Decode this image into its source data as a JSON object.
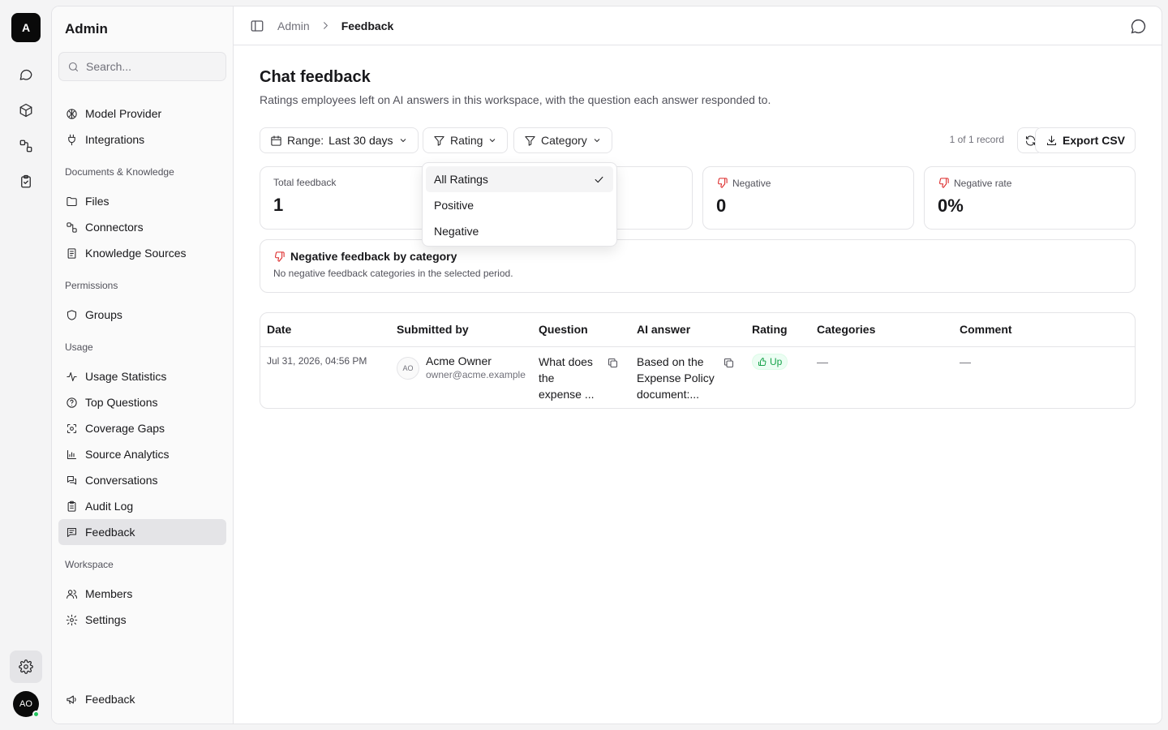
{
  "rail": {
    "logo_letter": "A",
    "user_initials": "AO",
    "icons": [
      "chat-icon",
      "cube-icon",
      "workflow-icon",
      "clipboard-check-icon",
      "settings-icon"
    ]
  },
  "sidebar": {
    "title": "Admin",
    "search_placeholder": "Search...",
    "top_items": [
      {
        "label": "Model Provider",
        "icon": "brain-icon"
      },
      {
        "label": "Integrations",
        "icon": "plug-icon"
      }
    ],
    "sections": [
      {
        "label": "Documents & Knowledge",
        "items": [
          {
            "label": "Files",
            "icon": "folder-icon"
          },
          {
            "label": "Connectors",
            "icon": "connector-icon"
          },
          {
            "label": "Knowledge Sources",
            "icon": "book-icon"
          }
        ]
      },
      {
        "label": "Permissions",
        "items": [
          {
            "label": "Groups",
            "icon": "shield-icon"
          }
        ]
      },
      {
        "label": "Usage",
        "items": [
          {
            "label": "Usage Statistics",
            "icon": "activity-icon"
          },
          {
            "label": "Top Questions",
            "icon": "help-circle-icon"
          },
          {
            "label": "Coverage Gaps",
            "icon": "scan-icon"
          },
          {
            "label": "Source Analytics",
            "icon": "bar-chart-icon"
          },
          {
            "label": "Conversations",
            "icon": "messages-icon"
          },
          {
            "label": "Audit Log",
            "icon": "clipboard-icon"
          },
          {
            "label": "Feedback",
            "icon": "message-square-icon",
            "active": true
          }
        ]
      },
      {
        "label": "Workspace",
        "items": [
          {
            "label": "Members",
            "icon": "users-icon"
          },
          {
            "label": "Settings",
            "icon": "gear-icon"
          }
        ]
      }
    ],
    "footer_item": {
      "label": "Feedback",
      "icon": "megaphone-icon"
    }
  },
  "breadcrumb": {
    "parent": "Admin",
    "current": "Feedback"
  },
  "page": {
    "title": "Chat feedback",
    "subtitle": "Ratings employees left on AI answers in this workspace, with the question each answer responded to."
  },
  "filters": {
    "range_label": "Range:",
    "range_value": "Last 30 days",
    "rating_label": "Rating",
    "category_label": "Category",
    "records_text": "1 of 1 record",
    "export_label": "Export CSV"
  },
  "stats": [
    {
      "label": "Total feedback",
      "value": "1"
    },
    {
      "label": "Negative",
      "value": "0"
    },
    {
      "label": "Negative rate",
      "value": "0%"
    }
  ],
  "category_box": {
    "title": "Negative feedback by category",
    "subtitle": "No negative feedback categories in the selected period."
  },
  "table": {
    "headers": [
      "Date",
      "Submitted by",
      "Question",
      "AI answer",
      "Rating",
      "Categories",
      "Comment"
    ],
    "rows": [
      {
        "date": "Jul 31, 2026, 04:56 PM",
        "initials": "AO",
        "name": "Acme Owner",
        "email": "owner@acme.example",
        "question_lines": [
          "What does",
          "the",
          "expense ..."
        ],
        "answer_lines": [
          "Based on the",
          "Expense Policy",
          "document:..."
        ],
        "rating": "Up",
        "categories": "—",
        "comment": "—"
      }
    ]
  },
  "rating_dropdown": {
    "options": [
      "All Ratings",
      "Positive",
      "Negative"
    ],
    "selected": "All Ratings"
  },
  "colors": {
    "accent": "#0a0a0a",
    "negative": "#dc2626",
    "positive": "#16a34a",
    "online": "#22c55e"
  }
}
